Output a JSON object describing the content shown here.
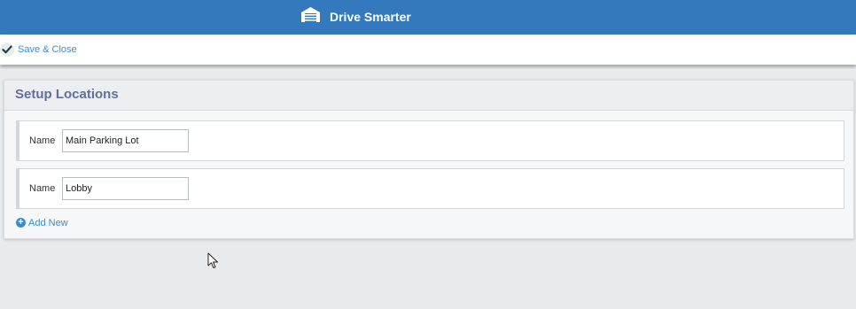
{
  "header": {
    "app_title": "Drive Smarter",
    "logo_icon": "garage-icon",
    "bar_color": "#3279bd"
  },
  "toolbar": {
    "save_close_label": "Save & Close",
    "save_icon": "check-icon"
  },
  "panel": {
    "title": "Setup Locations",
    "locations": [
      {
        "label": "Name",
        "value": "Main Parking Lot"
      },
      {
        "label": "Name",
        "value": "Lobby"
      }
    ],
    "add_new_label": "Add New",
    "add_icon": "plus-circle-icon"
  },
  "colors": {
    "link": "#3a8ccb",
    "panel_title": "#5f6f9e"
  }
}
